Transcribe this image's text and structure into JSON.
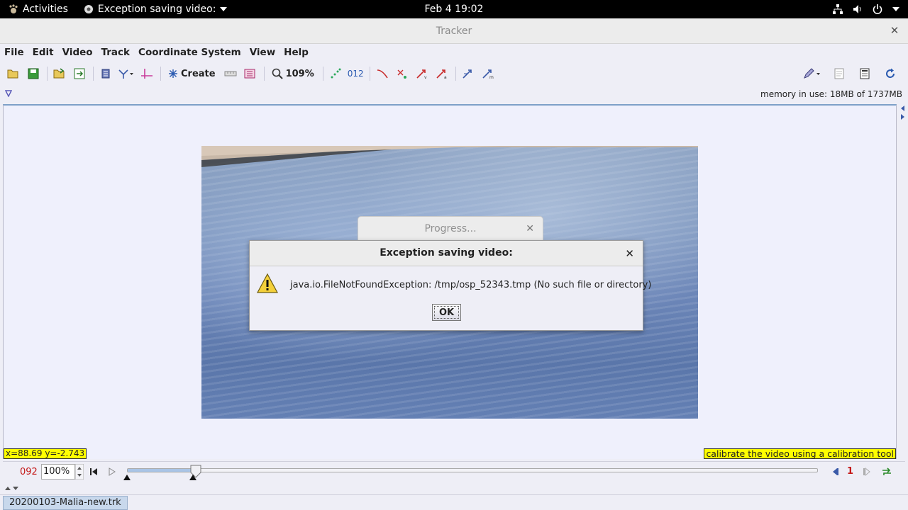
{
  "topbar": {
    "activities": "Activities",
    "app_menu": "Exception saving video:",
    "clock": "Feb 4  19:02"
  },
  "window": {
    "title": "Tracker"
  },
  "menubar": {
    "items": [
      "File",
      "Edit",
      "Video",
      "Track",
      "Coordinate System",
      "View",
      "Help"
    ]
  },
  "toolbar": {
    "create_label": "Create",
    "zoom_label": "109%",
    "point_range_label": "012"
  },
  "info": {
    "memory": "memory in use: 18MB of 1737MB"
  },
  "progress_dialog": {
    "title": "Progress..."
  },
  "exception_dialog": {
    "title": "Exception saving video:",
    "message": "java.io.FileNotFoundException: /tmp/osp_52343.tmp (No such file or directory)",
    "ok_label": "OK"
  },
  "overlays": {
    "coords": "x=88.69  y=-2.743",
    "hint": "calibrate the video using a calibration tool"
  },
  "player": {
    "frame": "092",
    "rate": "100%",
    "step_size": "1",
    "slider_position": 0.1
  },
  "tabs": {
    "file": "20200103-Malia-new.trk"
  },
  "colors": {
    "accent_red": "#c41818",
    "hint_yellow": "#ffff00",
    "canvas_bg": "#eff0fc"
  }
}
